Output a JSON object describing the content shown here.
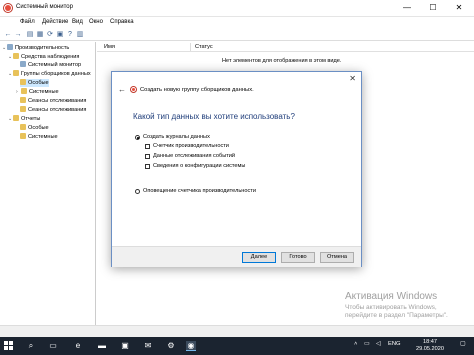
{
  "window": {
    "title": "Системный монитор",
    "controls": {
      "minimize": "—",
      "maximize": "☐",
      "close": "✕"
    }
  },
  "menu": {
    "items": [
      "Файл",
      "Действие",
      "Вид",
      "Окно",
      "Справка"
    ]
  },
  "tree": {
    "items": [
      {
        "label": "Производительность",
        "indent": 0
      },
      {
        "label": "Средства наблюдения",
        "indent": 1
      },
      {
        "label": "Системный монитор",
        "indent": 2
      },
      {
        "label": "Группы сборщиков данных",
        "indent": 1
      },
      {
        "label": "Особые",
        "indent": 2,
        "selected": true
      },
      {
        "label": "Системные",
        "indent": 2
      },
      {
        "label": "Сеансы отслеживания",
        "indent": 2
      },
      {
        "label": "Сеансы отслеживания",
        "indent": 2
      },
      {
        "label": "Отчеты",
        "indent": 1
      },
      {
        "label": "Особые",
        "indent": 2
      },
      {
        "label": "Системные",
        "indent": 2
      }
    ]
  },
  "list": {
    "columns": [
      "Имя",
      "Статус"
    ],
    "empty_message": "Нет элементов для отображения в этом виде."
  },
  "dialog": {
    "title": "Создать новую группу сборщиков данных.",
    "question": "Какой тип данных вы хотите использовать?",
    "option_create_logs": "Создать журналы данных",
    "checkboxes": [
      {
        "label": "Счетчик производительности",
        "checked": false
      },
      {
        "label": "Данные отслеживания событий",
        "checked": false
      },
      {
        "label": "Сведения о конфигурации системы",
        "checked": false
      }
    ],
    "option_alert": "Оповещение счетчика производительности",
    "buttons": {
      "next": "Далее",
      "finish": "Готово",
      "cancel": "Отмена"
    },
    "close": "✕",
    "back": "←"
  },
  "watermark": {
    "line1": "Активация Windows",
    "line2": "Чтобы активировать Windows,",
    "line3": "перейдите в раздел \"Параметры\"."
  },
  "taskbar": {
    "lang": "ENG",
    "time": "18:47",
    "date": "29.05.2020"
  },
  "colors": {
    "selection": "#cce8ff",
    "question_text": "#1f3d7a",
    "taskbar": "#1b2430",
    "accent": "#0078d7"
  }
}
